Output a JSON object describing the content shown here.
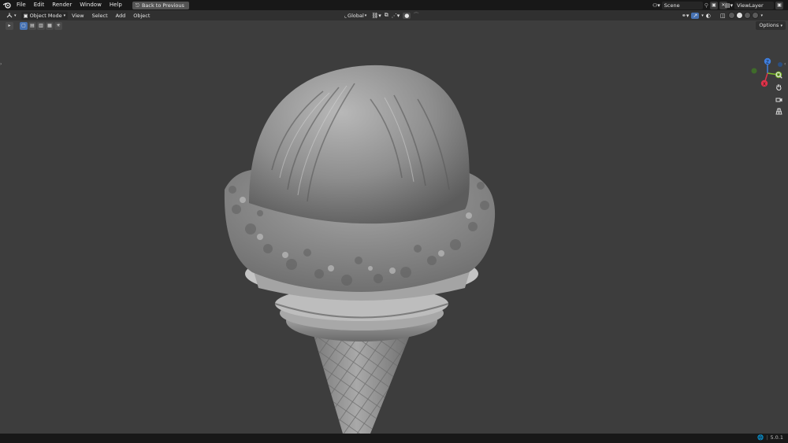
{
  "menu": {
    "items": [
      "File",
      "Edit",
      "Render",
      "Window",
      "Help"
    ],
    "back_label": "Back to Previous"
  },
  "scene": {
    "label": "Scene"
  },
  "view_layer": {
    "label": "ViewLayer"
  },
  "header": {
    "mode": "Object Mode",
    "menus": [
      "View",
      "Select",
      "Add",
      "Object"
    ],
    "transform_orientation": "Global"
  },
  "toolrow": {
    "options_label": "Options"
  },
  "gizmo": {
    "x": "X",
    "y": "Y",
    "z": "Z"
  },
  "status": {
    "version": "5.0.1"
  },
  "colors": {
    "accent": "#4772b3",
    "axis_x": "#e0334a",
    "axis_y": "#7fbf2a",
    "axis_z": "#3f7fe0",
    "background": "#3d3d3d"
  }
}
